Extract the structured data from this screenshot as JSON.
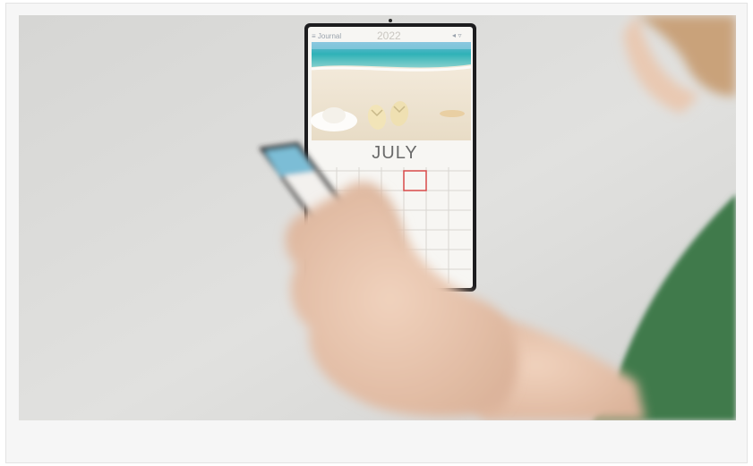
{
  "photo": {
    "alt": "Wall-mounted digital calendar display with beach photo, viewed behind a hand holding a smartphone",
    "device": {
      "status_left": "≡ Journal",
      "year": "2022",
      "month": "JULY"
    }
  },
  "colors": {
    "wall": "#dcdcda",
    "skin": "#e8c8b0",
    "shirt": "#3f7a4c",
    "hair": "#c9a27a",
    "frame": "#1d1d1f",
    "sea": "#3bb3b9",
    "sand": "#efe4d2",
    "highlight": "#d94a4a"
  }
}
